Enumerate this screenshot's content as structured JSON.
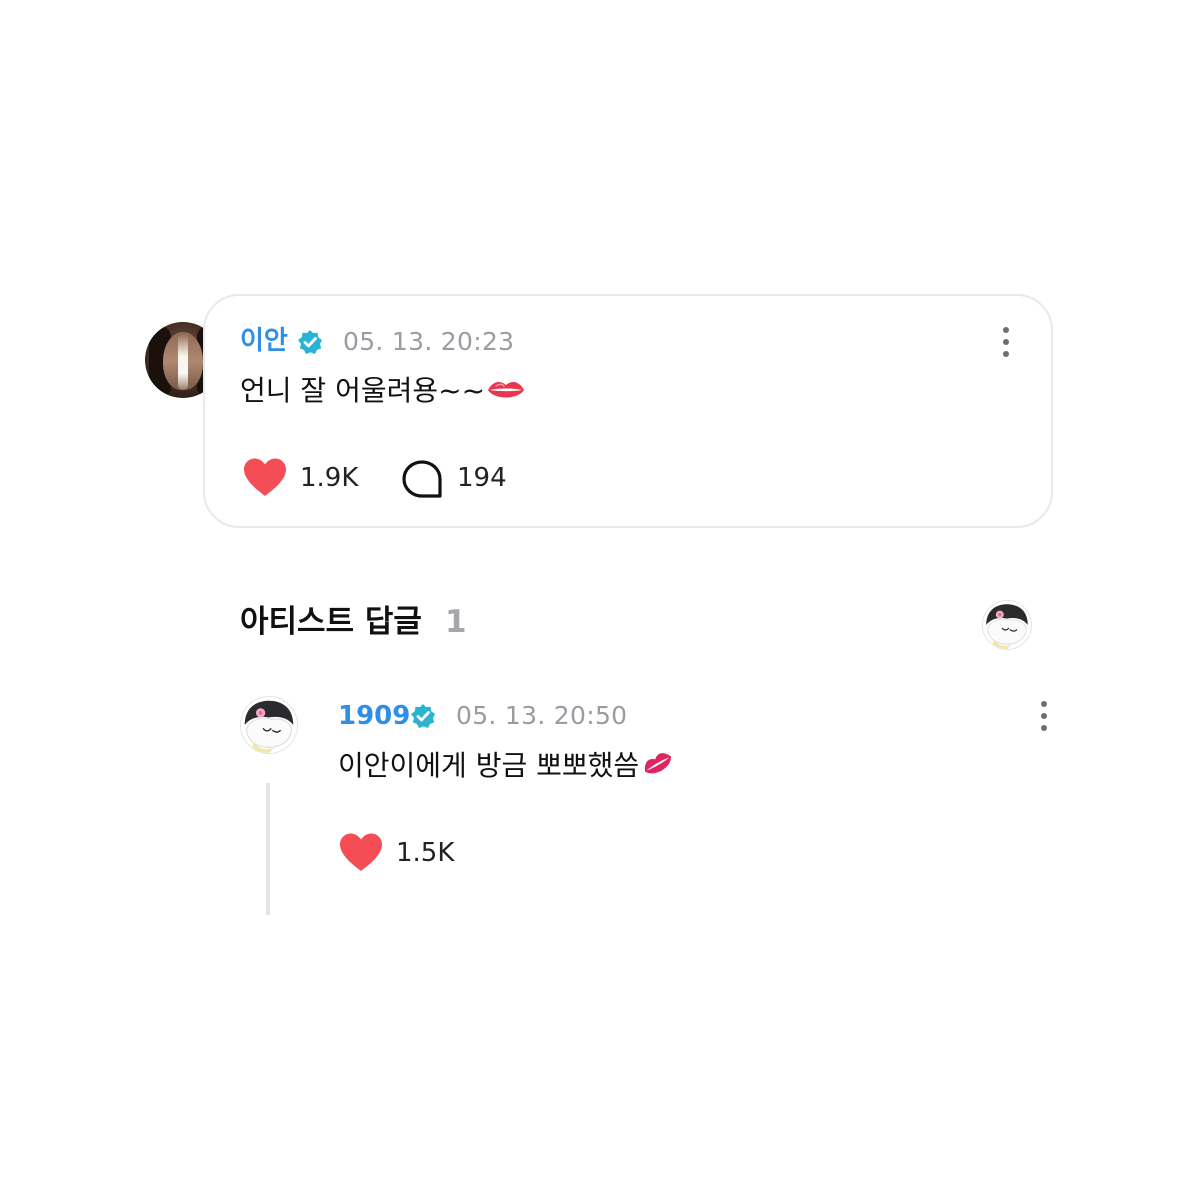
{
  "comment": {
    "username": "이안",
    "timestamp": "05. 13. 20:23",
    "text": "언니 잘 어울려용~~",
    "likes": "1.9K",
    "replies": "194"
  },
  "artist_replies": {
    "heading": "아티스트 답글",
    "count": "1"
  },
  "reply": {
    "username": "1909",
    "timestamp": "05. 13. 20:50",
    "text": "이안이에게 방금 뽀뽀했씀",
    "likes": "1.5K"
  },
  "colors": {
    "username": "#2f8fe8",
    "verified_badge": "#2bb3d4",
    "heart": "#f44d55",
    "timestamp": "#9a9ca2"
  },
  "icons": {
    "verified": "verified-badge-icon",
    "like": "heart-icon",
    "reply": "speech-bubble-icon",
    "more": "more-vertical-icon"
  }
}
